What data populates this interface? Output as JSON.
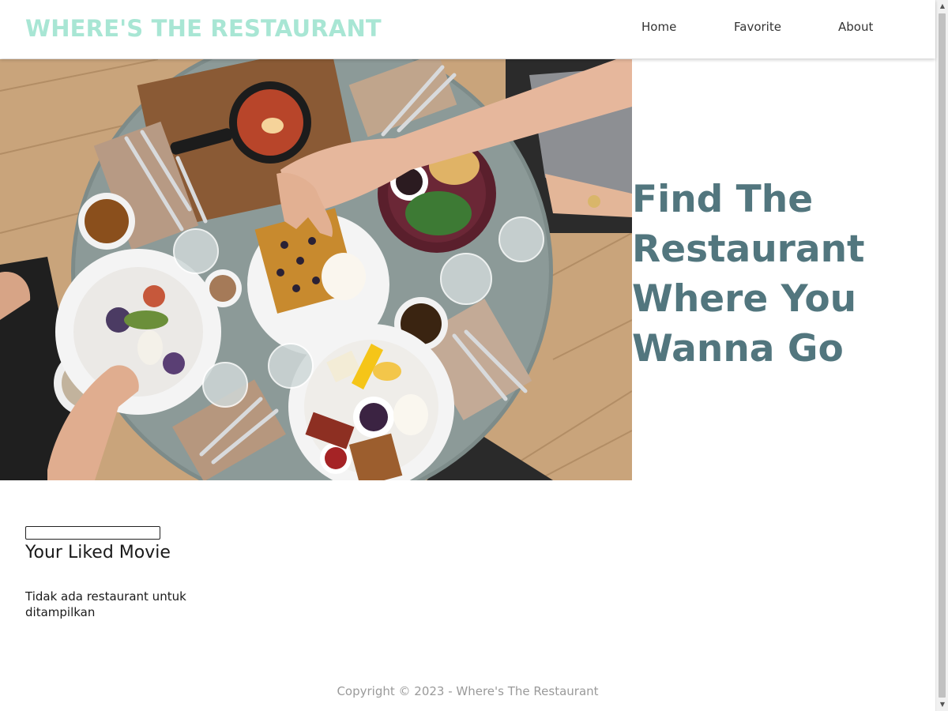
{
  "header": {
    "brand": "WHERE'S THE RESTAURANT",
    "nav": [
      {
        "label": "Home"
      },
      {
        "label": "Favorite"
      },
      {
        "label": "About"
      }
    ]
  },
  "hero": {
    "title": "Find The Restaurant Where You Wanna Go",
    "image_icon": "restaurant-table-photo"
  },
  "main": {
    "search": {
      "value": "",
      "placeholder": ""
    },
    "section_title": "Your Liked Movie",
    "empty_message": "Tidak ada restaurant untuk ditampilkan"
  },
  "footer": {
    "copyright": "Copyright © 2023 - Where's The Restaurant"
  },
  "colors": {
    "brand": "#a8e6d4",
    "hero_title": "#52767e",
    "footer_text": "#9a9a9a"
  },
  "scrollbar": {
    "up_icon": "▲",
    "down_icon": "▼"
  }
}
